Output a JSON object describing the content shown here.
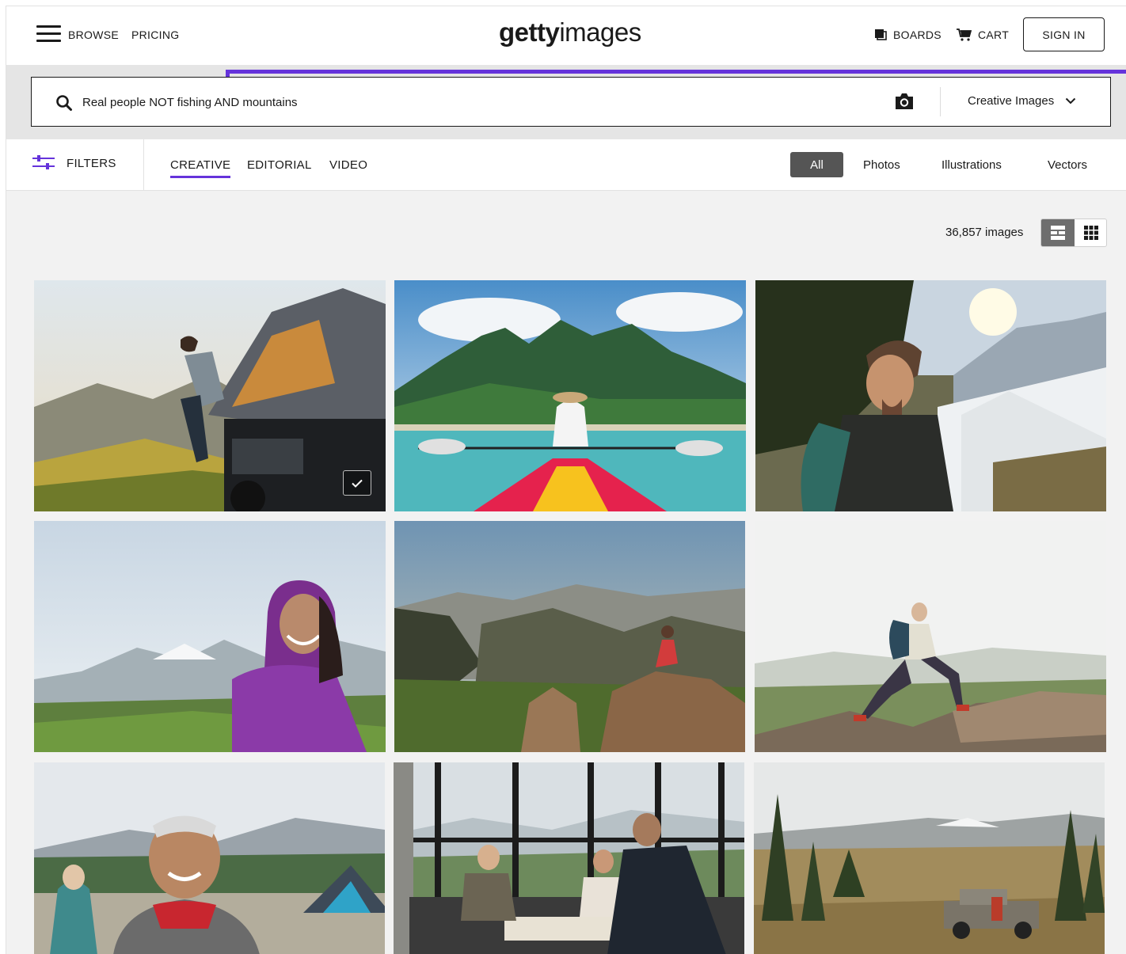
{
  "header": {
    "browse_label": "BROWSE",
    "pricing_label": "PRICING",
    "logo_bold": "getty",
    "logo_light": "images",
    "boards_label": "BOARDS",
    "cart_label": "CART",
    "signin_label": "SIGN IN"
  },
  "search": {
    "query": "Real people NOT fishing AND mountains",
    "scope_selected": "Creative Images"
  },
  "filters": {
    "filters_label": "FILTERS",
    "tabs": [
      {
        "label": "CREATIVE",
        "active": true
      },
      {
        "label": "EDITORIAL",
        "active": false
      },
      {
        "label": "VIDEO",
        "active": false
      }
    ],
    "types": [
      {
        "label": "All",
        "selected": true
      },
      {
        "label": "Photos",
        "selected": false
      },
      {
        "label": "Illustrations",
        "selected": false
      },
      {
        "label": "Vectors",
        "selected": false
      }
    ]
  },
  "results": {
    "count_label": "36,857 images"
  },
  "colors": {
    "accent": "#6533db",
    "selected_type_bg": "#555555"
  },
  "icons": {
    "menu": "hamburger-icon",
    "boards": "boards-icon",
    "cart": "cart-icon",
    "search": "search-icon",
    "camera": "camera-icon",
    "scope": "chevron-down-icon",
    "filters": "filters-icon",
    "mosaic_view": "mosaic-view-icon",
    "grid_view": "grid-view-icon",
    "selected": "checkmark-icon"
  }
}
